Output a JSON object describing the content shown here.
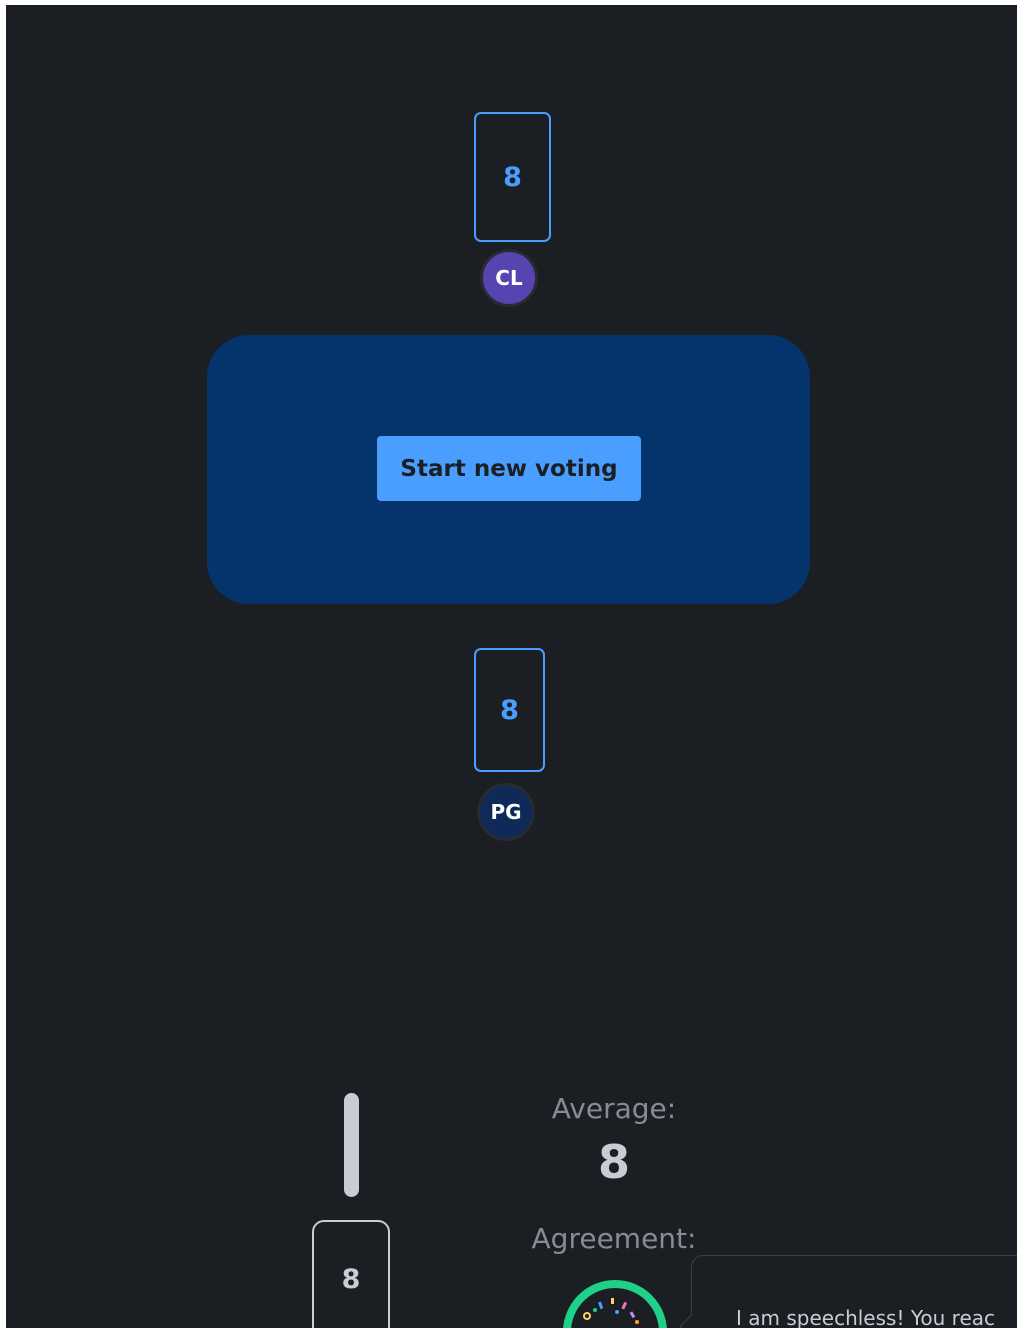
{
  "players": [
    {
      "initials": "CL",
      "vote": "8",
      "avatar_color": "#5744b0"
    },
    {
      "initials": "PG",
      "vote": "8",
      "avatar_color": "#0f2a59"
    }
  ],
  "table": {
    "button_label": "Start new voting"
  },
  "results": {
    "average_label": "Average:",
    "average_value": "8",
    "agreement_label": "Agreement:",
    "card_value": "8",
    "bubble_text": "I am speechless! You reac"
  },
  "colors": {
    "background": "#1b1f23",
    "accent": "#4a9eff",
    "table": "#05346c",
    "agreement": "#1fd08a"
  }
}
